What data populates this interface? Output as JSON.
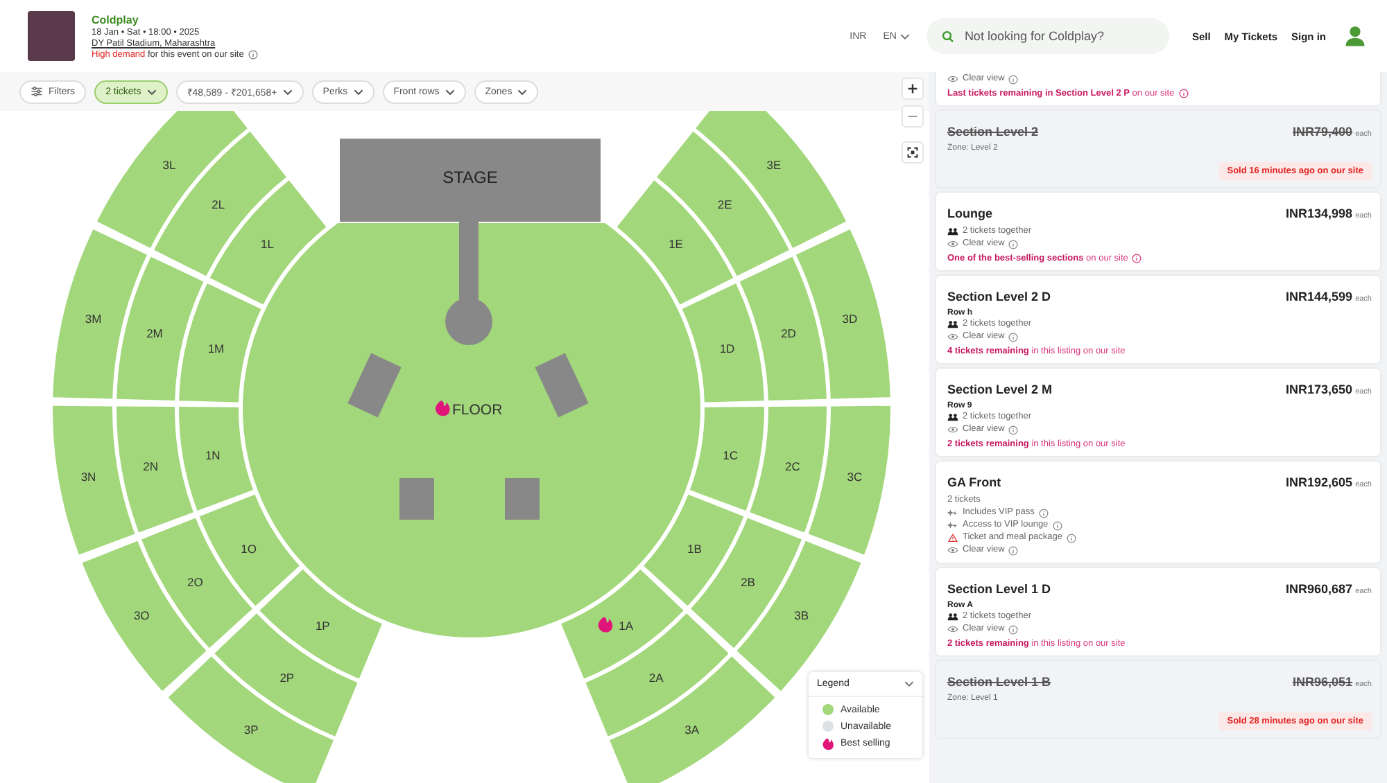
{
  "event": {
    "title": "Coldplay",
    "date": "18 Jan • Sat • 18:00 • 2025",
    "venue": "DY Patil Stadium, Maharashtra",
    "demand": {
      "highlight": "High demand",
      "text": "for this event on our site"
    }
  },
  "nav": {
    "currency": "INR",
    "language": "EN",
    "search": {
      "placeholder": "Not looking for Coldplay?"
    },
    "links": [
      "Sell",
      "My Tickets",
      "Sign in"
    ]
  },
  "filters": [
    {
      "label": "Filters",
      "kind": "filters",
      "selected": false
    },
    {
      "label": "2 tickets",
      "kind": "dropdown",
      "selected": true
    },
    {
      "label": "₹48,589 - ₹201,658+",
      "kind": "dropdown",
      "selected": false
    },
    {
      "label": "Perks",
      "kind": "dropdown",
      "selected": false
    },
    {
      "label": "Front rows",
      "kind": "dropdown",
      "selected": false
    },
    {
      "label": "Zones",
      "kind": "dropdown",
      "selected": false
    }
  ],
  "map": {
    "stage": "STAGE",
    "floor": {
      "label": "FLOOR",
      "best_selling": true
    },
    "sections": [
      {
        "label": "1L",
        "best_selling": false
      },
      {
        "label": "1M",
        "best_selling": false
      },
      {
        "label": "1N",
        "best_selling": false
      },
      {
        "label": "1O",
        "best_selling": false
      },
      {
        "label": "1P",
        "best_selling": false
      },
      {
        "label": "2L",
        "best_selling": false
      },
      {
        "label": "2M",
        "best_selling": false
      },
      {
        "label": "2N",
        "best_selling": false
      },
      {
        "label": "2O",
        "best_selling": false
      },
      {
        "label": "2P",
        "best_selling": false
      },
      {
        "label": "3L",
        "best_selling": false
      },
      {
        "label": "3M",
        "best_selling": false
      },
      {
        "label": "3N",
        "best_selling": false
      },
      {
        "label": "3O",
        "best_selling": false
      },
      {
        "label": "3P",
        "best_selling": false
      },
      {
        "label": "1E",
        "best_selling": false
      },
      {
        "label": "1D",
        "best_selling": false
      },
      {
        "label": "1C",
        "best_selling": false
      },
      {
        "label": "1B",
        "best_selling": false
      },
      {
        "label": "1A",
        "best_selling": true
      },
      {
        "label": "2E",
        "best_selling": false
      },
      {
        "label": "2D",
        "best_selling": false
      },
      {
        "label": "2C",
        "best_selling": false
      },
      {
        "label": "2B",
        "best_selling": false
      },
      {
        "label": "2A",
        "best_selling": false
      },
      {
        "label": "3E",
        "best_selling": false
      },
      {
        "label": "3D",
        "best_selling": false
      },
      {
        "label": "3C",
        "best_selling": false
      },
      {
        "label": "3B",
        "best_selling": false
      },
      {
        "label": "3A",
        "best_selling": false
      }
    ],
    "legend": {
      "title": "Legend",
      "items": [
        {
          "label": "Available",
          "kind": "available"
        },
        {
          "label": "Unavailable",
          "kind": "unavailable"
        },
        {
          "label": "Best selling",
          "kind": "best_selling"
        }
      ]
    }
  },
  "listings": [
    {
      "sold": false,
      "features": [
        {
          "kind": "view",
          "text": "Clear view",
          "info": true
        }
      ],
      "message": {
        "text": "**Last tickets remaining in Section Level 2 P** on our site",
        "info": true
      }
    },
    {
      "sold": true,
      "title": "Section Level 2",
      "price": "INR79,400",
      "unit": "each",
      "subtitle": "Zone: Level 2",
      "sold_note": "Sold 16 minutes ago on our site"
    },
    {
      "sold": false,
      "title": "Lounge",
      "price": "INR134,998",
      "unit": "each",
      "features": [
        {
          "kind": "together",
          "text": "2 tickets together",
          "info": false
        },
        {
          "kind": "view",
          "text": "Clear view",
          "info": true
        }
      ],
      "message": {
        "text": "**One of the best-selling sections** on our site",
        "info": true
      }
    },
    {
      "sold": false,
      "title": "Section Level 2 D",
      "price": "INR144,599",
      "unit": "each",
      "row": "Row h",
      "features": [
        {
          "kind": "together",
          "text": "2 tickets together",
          "info": false
        },
        {
          "kind": "view",
          "text": "Clear view",
          "info": true
        }
      ],
      "message": {
        "text": "**4 tickets remaining** in this listing on our site",
        "info": false
      }
    },
    {
      "sold": false,
      "title": "Section Level 2 M",
      "price": "INR173,650",
      "unit": "each",
      "row": "Row 9",
      "features": [
        {
          "kind": "together",
          "text": "2 tickets together",
          "info": false
        },
        {
          "kind": "view",
          "text": "Clear view",
          "info": true
        }
      ],
      "message": {
        "text": "**2 tickets remaining** in this listing on our site",
        "info": false
      }
    },
    {
      "sold": false,
      "title": "GA Front",
      "price": "INR192,605",
      "unit": "each",
      "features": [
        {
          "kind": "plain",
          "text": "2 tickets",
          "info": false
        },
        {
          "kind": "perk",
          "text": "Includes VIP pass",
          "info": true
        },
        {
          "kind": "perk",
          "text": "Access to VIP lounge",
          "info": true
        },
        {
          "kind": "warning",
          "text": "Ticket and meal package",
          "info": true
        },
        {
          "kind": "view",
          "text": "Clear view",
          "info": true
        }
      ]
    },
    {
      "sold": false,
      "title": "Section Level 1 D",
      "price": "INR960,687",
      "unit": "each",
      "row": "Row A",
      "features": [
        {
          "kind": "together",
          "text": "2 tickets together",
          "info": false
        },
        {
          "kind": "view",
          "text": "Clear view",
          "info": true
        }
      ],
      "message": {
        "text": "**2 tickets remaining** in this listing on our site",
        "info": false
      }
    },
    {
      "sold": true,
      "title": "Section Level 1 B",
      "price": "INR96,051",
      "unit": "each",
      "subtitle": "Zone: Level 1",
      "sold_note": "Sold 28 minutes ago on our site"
    }
  ]
}
